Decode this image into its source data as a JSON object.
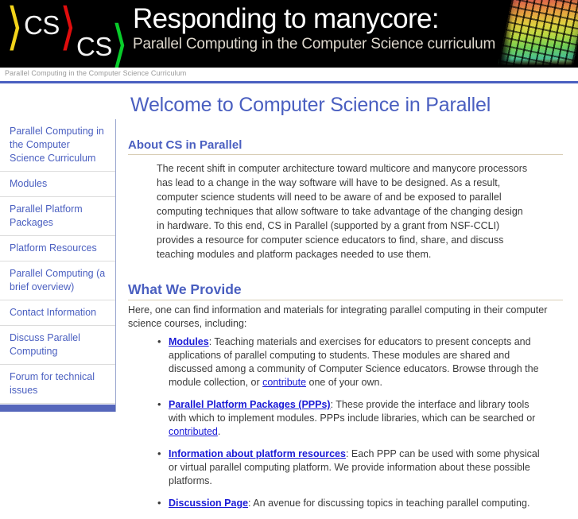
{
  "banner": {
    "logo": {
      "bracket_yellow": "⟩",
      "cs_upper": "CS",
      "bracket_red": "⟩",
      "cs_lower": "CS",
      "bracket_green": "⟩",
      "colors": {
        "yellow": "#f3d41a",
        "red": "#e00d0d",
        "green": "#08cc2a",
        "text": "#f2f2f2",
        "background": "#000000"
      }
    },
    "title": "Responding to manycore:",
    "subtitle": "Parallel Computing in the Computer Science curriculum",
    "wafer_icon": "silicon-wafer-photo"
  },
  "breadcrumb": {
    "text": "Parallel Computing in the Computer Science Curriculum",
    "rule_color": "#4a5fc0"
  },
  "sidebar": {
    "items": [
      {
        "label": "Parallel Computing in the Computer Science Curriculum"
      },
      {
        "label": "Modules"
      },
      {
        "label": "Parallel Platform Packages"
      },
      {
        "label": "Platform Resources"
      },
      {
        "label": "Parallel Computing (a brief overview)"
      },
      {
        "label": "Contact Information"
      },
      {
        "label": "Discuss Parallel Computing"
      },
      {
        "label": "Forum for technical issues"
      }
    ],
    "link_color": "#4a5fc0",
    "bottom_bar_color": "#5566bb"
  },
  "main": {
    "page_title": "Welcome to Computer Science in Parallel",
    "about": {
      "heading": "About CS in Parallel",
      "body": "The recent shift in computer architecture toward multicore and manycore processors has lead to a change in the way software will have to be designed. As a result, computer science students will need to be aware of and be exposed to parallel computing techniques that allow software to take advantage of the changing design in hardware. To this end, CS in Parallel (supported by a grant from NSF-CCLI) provides a resource for computer science educators to find, share, and discuss teaching modules and platform packages needed to use them."
    },
    "provide": {
      "heading": "What We Provide",
      "intro": "Here, one can find information and materials for integrating parallel computing in their computer science courses, including:",
      "items": [
        {
          "link": "Modules",
          "text_1": ": Teaching materials and exercises for educators to present concepts and applications of parallel computing to students. These modules are shared and discussed among a community of Computer Science educators. Browse through the module collection, or ",
          "inline_link": "contribute",
          "text_2": " one of your own."
        },
        {
          "link": "Parallel Platform Packages (PPPs)",
          "text_1": ": These provide the interface and library tools with which to implement modules. PPPs include libraries, which can be searched or ",
          "inline_link": "contributed",
          "text_2": "."
        },
        {
          "link": "Information about platform resources",
          "text_1": ": Each PPP can be used with some physical or virtual parallel computing platform. We provide information about these possible platforms.",
          "inline_link": "",
          "text_2": ""
        },
        {
          "link": "Discussion Page",
          "text_1": ": An avenue for discussing topics in teaching parallel computing.",
          "inline_link": "",
          "text_2": ""
        }
      ]
    },
    "heading_color": "#4a5fc0",
    "link_color": "#1a1ad6",
    "heading_rule_color": "#d8cdb4"
  }
}
